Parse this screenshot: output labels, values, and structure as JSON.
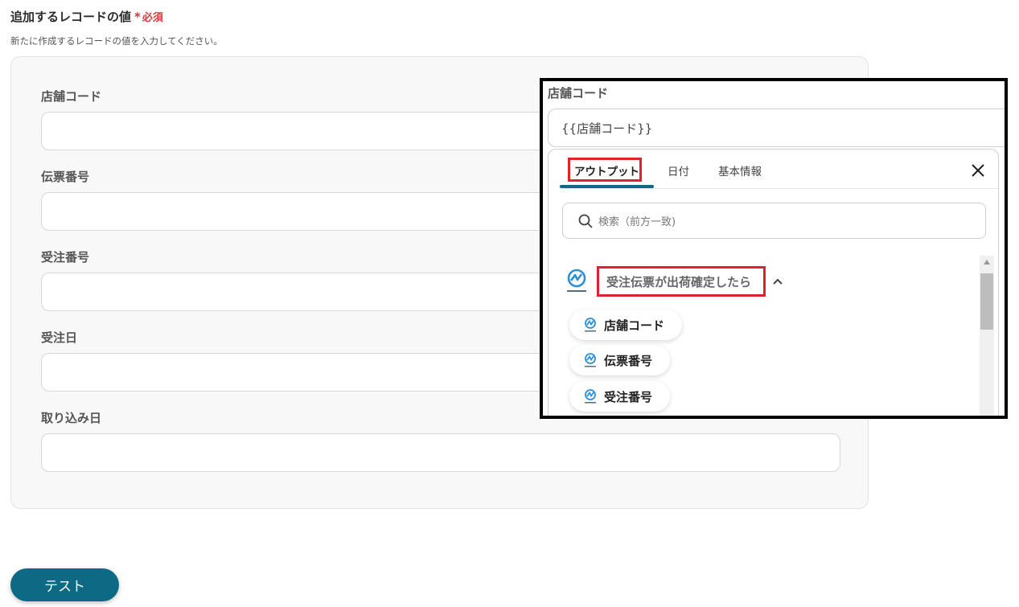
{
  "section": {
    "title": "追加するレコードの値",
    "required_mark": "*",
    "required_label": "必須",
    "description": "新たに作成するレコードの値を入力してください。"
  },
  "fields": [
    {
      "label": "店舗コード",
      "value": ""
    },
    {
      "label": "伝票番号",
      "value": ""
    },
    {
      "label": "受注番号",
      "value": ""
    },
    {
      "label": "受注日",
      "value": ""
    },
    {
      "label": "取り込み日",
      "value": ""
    }
  ],
  "test_button": {
    "label": "テスト"
  },
  "popup": {
    "field_label": "店舗コード",
    "field_value": "{{店舗コード}}",
    "tabs": [
      {
        "label": "アウトプット",
        "active": true
      },
      {
        "label": "日付",
        "active": false
      },
      {
        "label": "基本情報",
        "active": false
      }
    ],
    "close_icon": "close-icon",
    "search_placeholder": "検索（前方一致)",
    "group_title": "受注伝票が出荷確定したら",
    "items": [
      {
        "label": "店舗コード"
      },
      {
        "label": "伝票番号"
      },
      {
        "label": "受注番号"
      }
    ]
  },
  "colors": {
    "accent": "#0e6a84",
    "required": "#e0353c",
    "highlight_box": "#e0222b",
    "logo": "#2f8fd6"
  }
}
